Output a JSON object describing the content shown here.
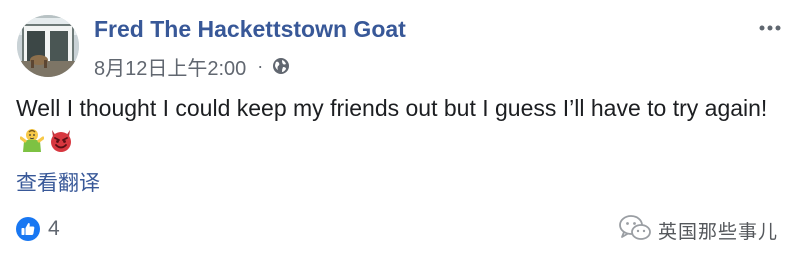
{
  "post": {
    "author": "Fred The Hackettstown Goat",
    "timestamp": "8月12日上午2:00",
    "separator": "·",
    "privacy_icon": "globe-icon",
    "menu_icon": "more-options-icon",
    "text": "Well I thought I could keep my friends out but I guess I’ll have to try again!",
    "emojis": [
      "person-shrugging-emoji",
      "smiling-imp-emoji"
    ],
    "translate_link": "查看翻译"
  },
  "reactions": {
    "icon": "like-icon",
    "count": "4"
  },
  "watermark": {
    "icon": "wechat-icon",
    "text": "英国那些事儿"
  },
  "colors": {
    "link": "#385898",
    "text": "#1c1e21",
    "meta": "#616770",
    "like_blue": "#1877f2"
  }
}
